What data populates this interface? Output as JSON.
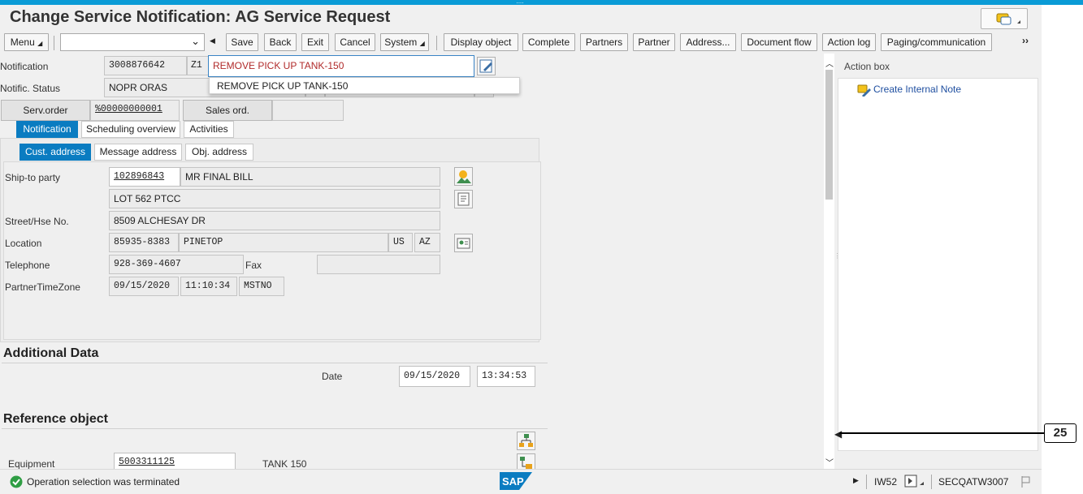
{
  "window": {
    "title": "Change Service Notification: AG Service Request"
  },
  "toolbar": {
    "menu_label": "Menu",
    "buttons": [
      "Save",
      "Back",
      "Exit",
      "Cancel",
      "System",
      "Display object",
      "Complete",
      "Partners",
      "Partner",
      "Address...",
      "Document flow",
      "Action log",
      "Paging/communication"
    ]
  },
  "header": {
    "notification_label": "Notification",
    "notification_number": "3008876642",
    "notification_type": "Z1",
    "notification_desc": "REMOVE PICK UP TANK-150",
    "status_label": "Notific. Status",
    "status_value": "NOPR ORAS",
    "dropdown_option": "REMOVE PICK UP TANK-150",
    "serv_order_button": "Serv.order",
    "serv_order_value": "%00000000001",
    "sales_ord_button": "Sales ord."
  },
  "tabs": [
    "Notification",
    "Scheduling overview",
    "Activities"
  ],
  "subtabs": [
    "Cust. address",
    "Message address",
    "Obj. address"
  ],
  "address": {
    "ship_to_label": "Ship-to party",
    "ship_to_number": "102896843",
    "ship_to_name": "MR FINAL BILL",
    "line2": "LOT 562 PTCC",
    "street_label": "Street/Hse No.",
    "street_value": "8509 ALCHESAY DR",
    "location_label": "Location",
    "postal_code": "85935-8383",
    "city": "PINETOP",
    "country": "US",
    "region": "AZ",
    "telephone_label": "Telephone",
    "telephone_value": "928-369-4607",
    "fax_label": "Fax",
    "tz_label": "PartnerTimeZone",
    "tz_date": "09/15/2020",
    "tz_time": "11:10:34",
    "tz_zone": "MSTNO"
  },
  "additional": {
    "title": "Additional Data",
    "date_label": "Date",
    "date_value": "09/15/2020",
    "time_value": "13:34:53"
  },
  "reference": {
    "title": "Reference object",
    "equipment_label": "Equipment",
    "equipment_value": "5003311125",
    "equipment_desc": "TANK 150"
  },
  "action_box": {
    "title": "Action box",
    "items": [
      "Create Internal Note"
    ]
  },
  "status_bar": {
    "message": "Operation selection was terminated",
    "transaction": "IW52",
    "system": "SECQATW3007"
  },
  "callout": {
    "label": "25"
  },
  "colors": {
    "accent": "#0a7cc1",
    "topbar": "#0a9bd6",
    "desc_red": "#b02a2a"
  }
}
